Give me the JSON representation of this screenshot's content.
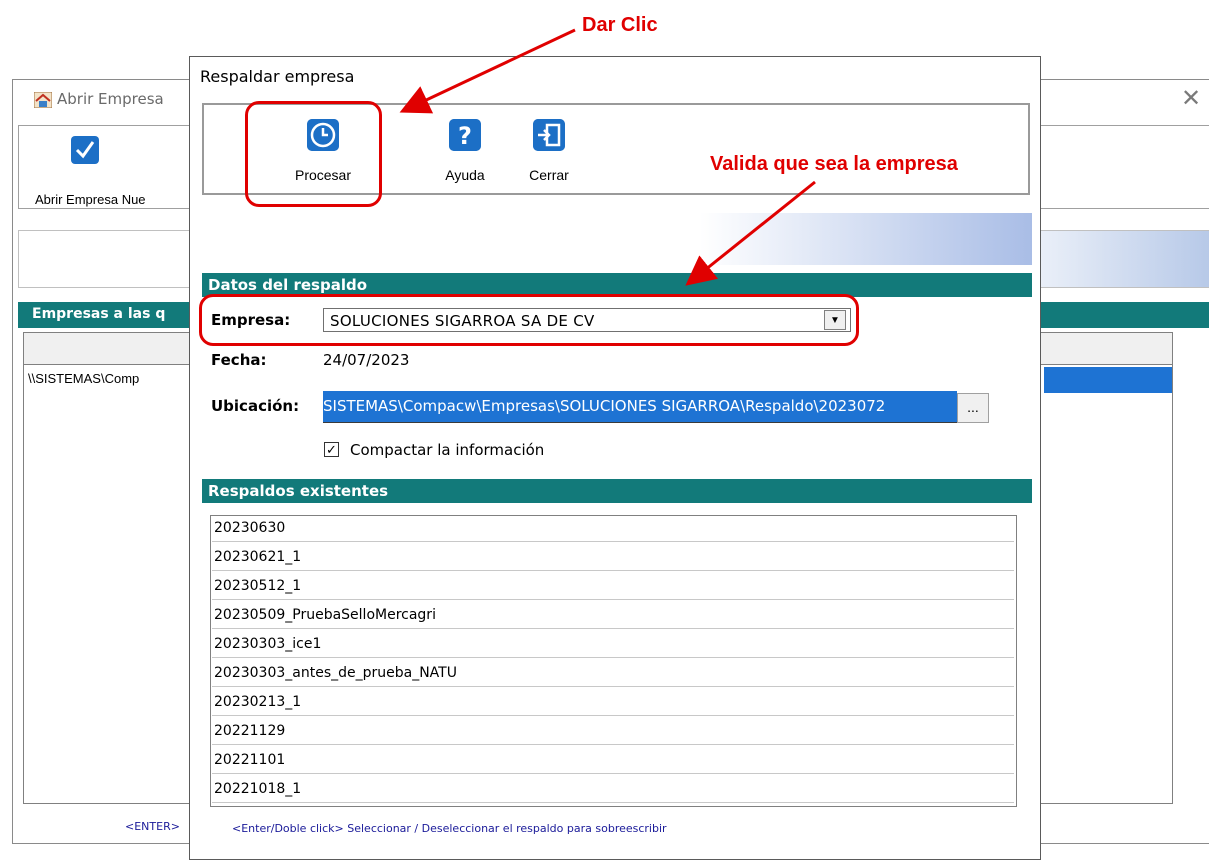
{
  "background_window": {
    "title": "Abrir Empresa",
    "toolbar_label": "Abrir Empresa  Nue",
    "section_title": "Empresas a las q",
    "row_text": "\\\\SISTEMAS\\Comp",
    "status_text": "<ENTER>"
  },
  "dialog": {
    "title": "Respaldar empresa",
    "toolbar": {
      "procesar": "Procesar",
      "ayuda": "Ayuda",
      "cerrar": "Cerrar"
    },
    "datos_section": "Datos del respaldo",
    "empresa_label": "Empresa:",
    "empresa_value": "SOLUCIONES SIGARROA SA DE CV",
    "fecha_label": "Fecha:",
    "fecha_value": "24/07/2023",
    "ubicacion_label": "Ubicación:",
    "ubicacion_value": "SISTEMAS\\Compacw\\Empresas\\SOLUCIONES SIGARROA\\Respaldo\\2023072",
    "browse_label": "...",
    "compactar_label": "Compactar la información",
    "compactar_checked": true,
    "respaldos_section": "Respaldos existentes",
    "respaldos": [
      "20230630",
      "20230621_1",
      "20230512_1",
      "20230509_PruebaSelloMercagri",
      "20230303_ice1",
      "20230303_antes_de_prueba_NATU",
      "20230213_1",
      "20221129",
      "20221101",
      "20221018_1"
    ],
    "status_text": "<Enter/Doble click> Seleccionar / Deseleccionar el respaldo para sobreescribir"
  },
  "annotations": {
    "dar_clic": "Dar Clic",
    "valida": "Valida que sea la empresa"
  },
  "colors": {
    "section": "#127a7a",
    "selection": "#1e73d3",
    "annotation": "#e00000",
    "icon_blue": "#1c6fc6"
  },
  "icons": [
    "home-icon",
    "checkmark-icon",
    "clock-icon",
    "help-icon",
    "exit-icon",
    "close-icon",
    "dropdown-arrow-icon"
  ]
}
